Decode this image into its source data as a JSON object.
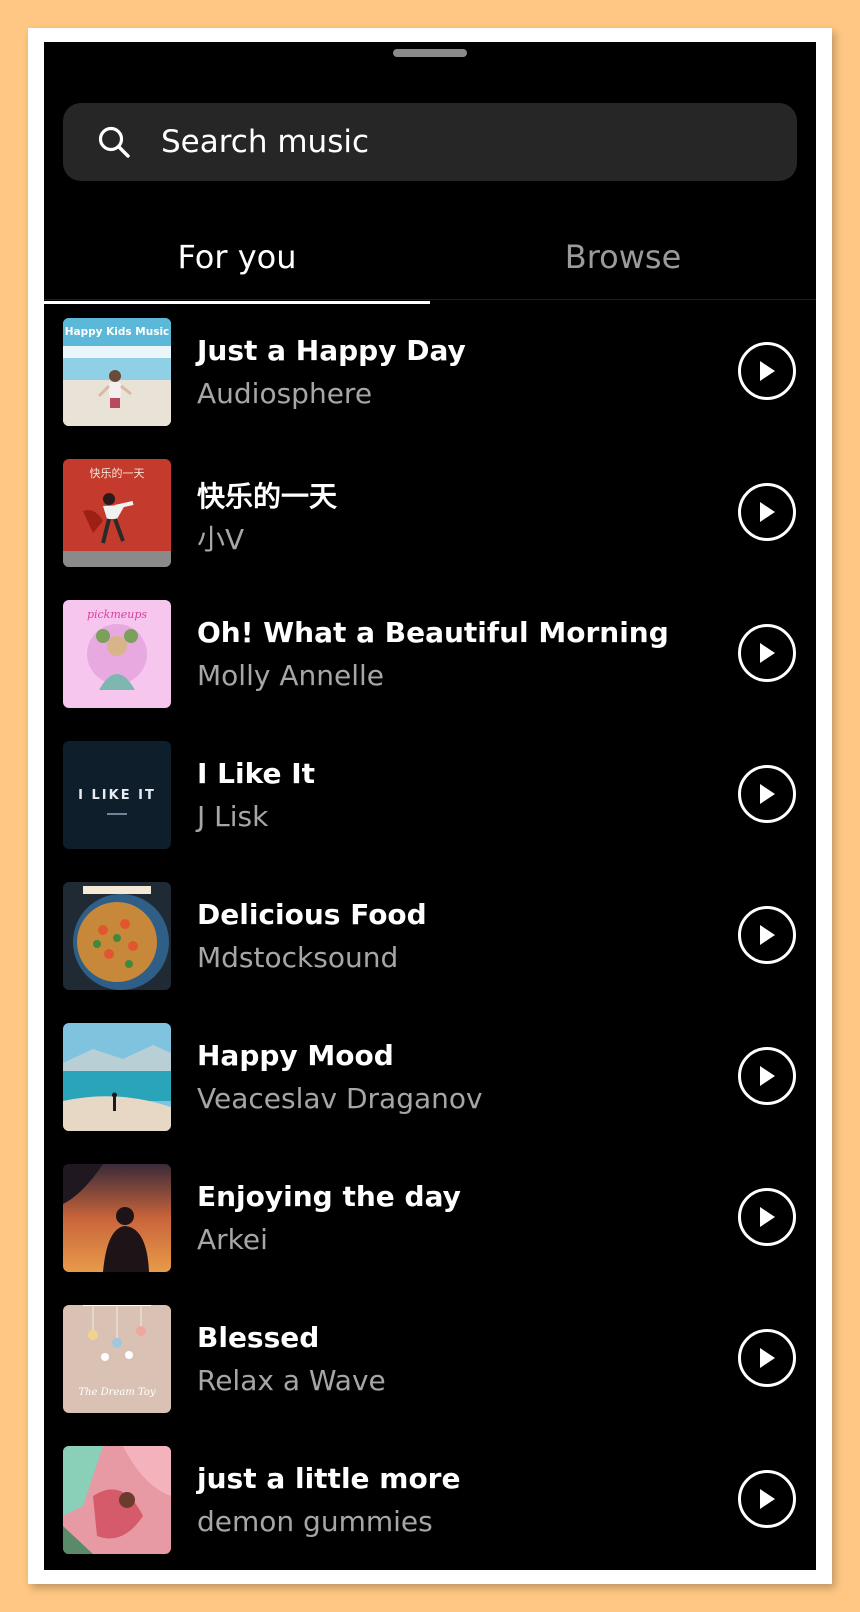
{
  "search": {
    "placeholder": "Search music",
    "icon": "search-icon"
  },
  "tabs": [
    {
      "label": "For you",
      "selected": true
    },
    {
      "label": "Browse",
      "selected": false
    }
  ],
  "tracks": [
    {
      "title": "Just a Happy Day",
      "artist": "Audiosphere",
      "cover_text": "Happy Kids Music"
    },
    {
      "title": "快乐的一天",
      "artist": "小V",
      "cover_text": "快乐的一天"
    },
    {
      "title": "Oh! What a Beautiful Morning",
      "artist": "Molly Annelle",
      "cover_text": "pickmeups"
    },
    {
      "title": "I Like It",
      "artist": "J Lisk",
      "cover_text": "I LIKE IT"
    },
    {
      "title": "Delicious Food",
      "artist": "Mdstocksound",
      "cover_text": ""
    },
    {
      "title": "Happy Mood",
      "artist": "Veaceslav Draganov",
      "cover_text": ""
    },
    {
      "title": "Enjoying the day",
      "artist": "Arkei",
      "cover_text": ""
    },
    {
      "title": "Blessed",
      "artist": "Relax a Wave",
      "cover_text": "The Dream Toy"
    },
    {
      "title": "just a little more",
      "artist": "demon gummies",
      "cover_text": ""
    }
  ],
  "colors": {
    "background": "#000000",
    "search_bg": "#262626",
    "secondary_text": "#a6a6a6",
    "page_bg": "#FFC783"
  }
}
